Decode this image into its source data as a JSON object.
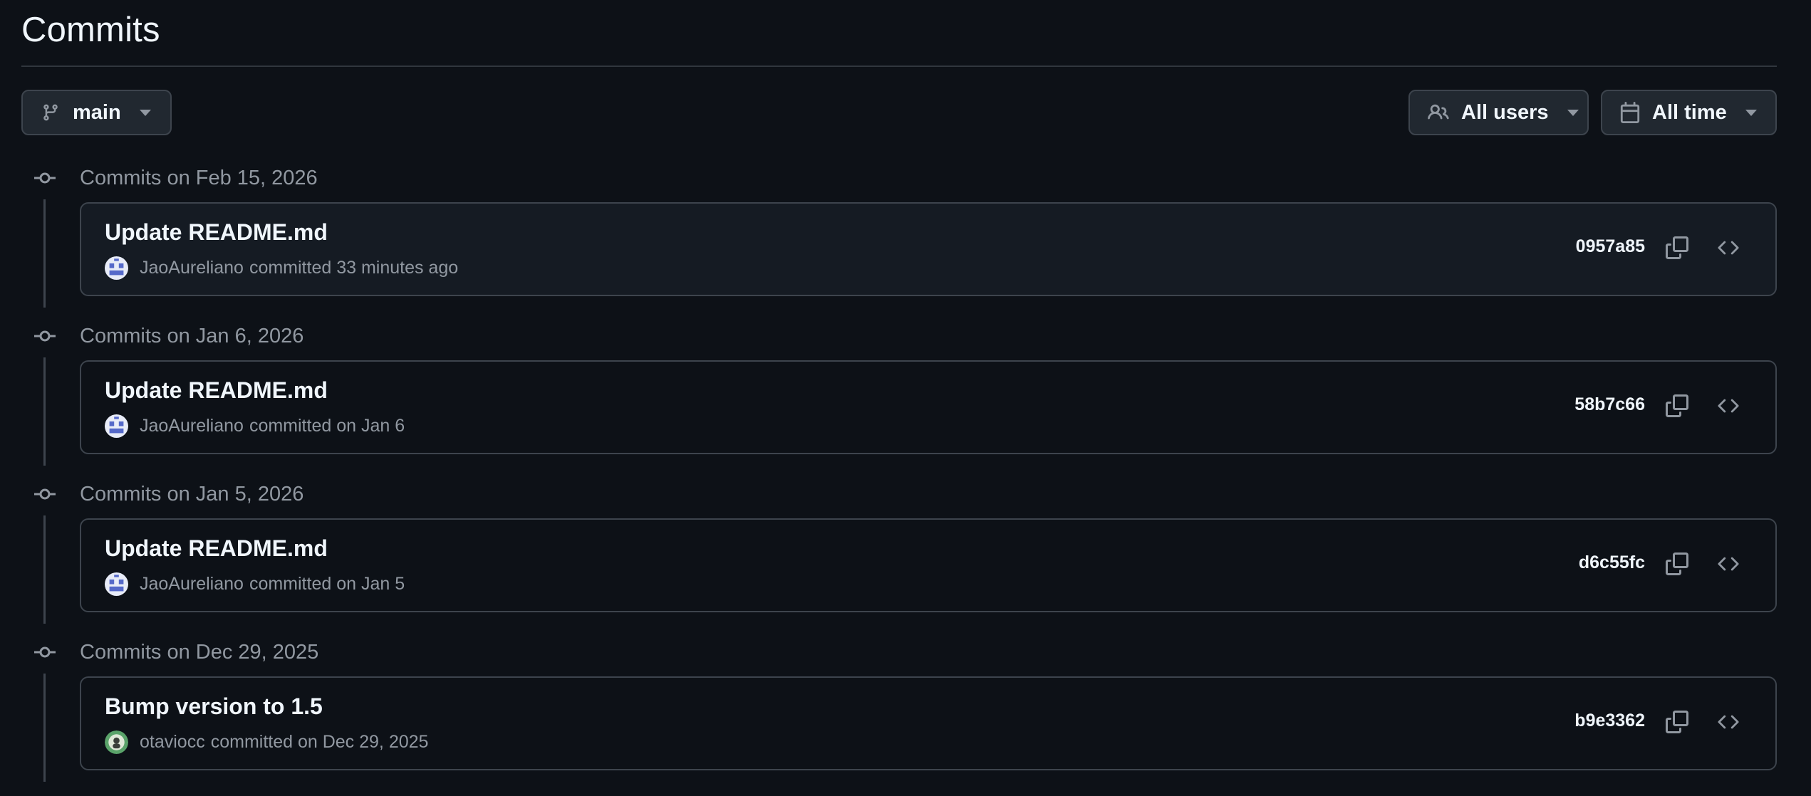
{
  "page": {
    "title": "Commits"
  },
  "toolbar": {
    "branch_label": "main",
    "users_label": "All users",
    "time_label": "All time"
  },
  "groups": [
    {
      "title": "Commits on Feb 15, 2026",
      "commit": {
        "message": "Update README.md",
        "author": "JaoAureliano",
        "when": "committed 33 minutes ago",
        "sha": "0957a85",
        "avatar": "identicon-blue"
      }
    },
    {
      "title": "Commits on Jan 6, 2026",
      "commit": {
        "message": "Update README.md",
        "author": "JaoAureliano",
        "when": "committed on Jan 6",
        "sha": "58b7c66",
        "avatar": "identicon-blue"
      }
    },
    {
      "title": "Commits on Jan 5, 2026",
      "commit": {
        "message": "Update README.md",
        "author": "JaoAureliano",
        "when": "committed on Jan 5",
        "sha": "d6c55fc",
        "avatar": "identicon-blue"
      }
    },
    {
      "title": "Commits on Dec 29, 2025",
      "commit": {
        "message": "Bump version to 1.5",
        "author": "otaviocc",
        "when": "committed on Dec 29, 2025",
        "sha": "b9e3362",
        "avatar": "photo-green"
      }
    }
  ],
  "icons": {
    "branch": "git-branch-icon",
    "users": "people-icon",
    "time": "calendar-icon",
    "commit_node": "git-commit-icon",
    "copy": "copy-icon",
    "browse": "code-icon"
  },
  "colors": {
    "background": "#0d1117",
    "card_highlight": "#151b23",
    "border": "#3d444d",
    "muted_text": "#9198a1",
    "primary_text": "#f0f6fc"
  }
}
